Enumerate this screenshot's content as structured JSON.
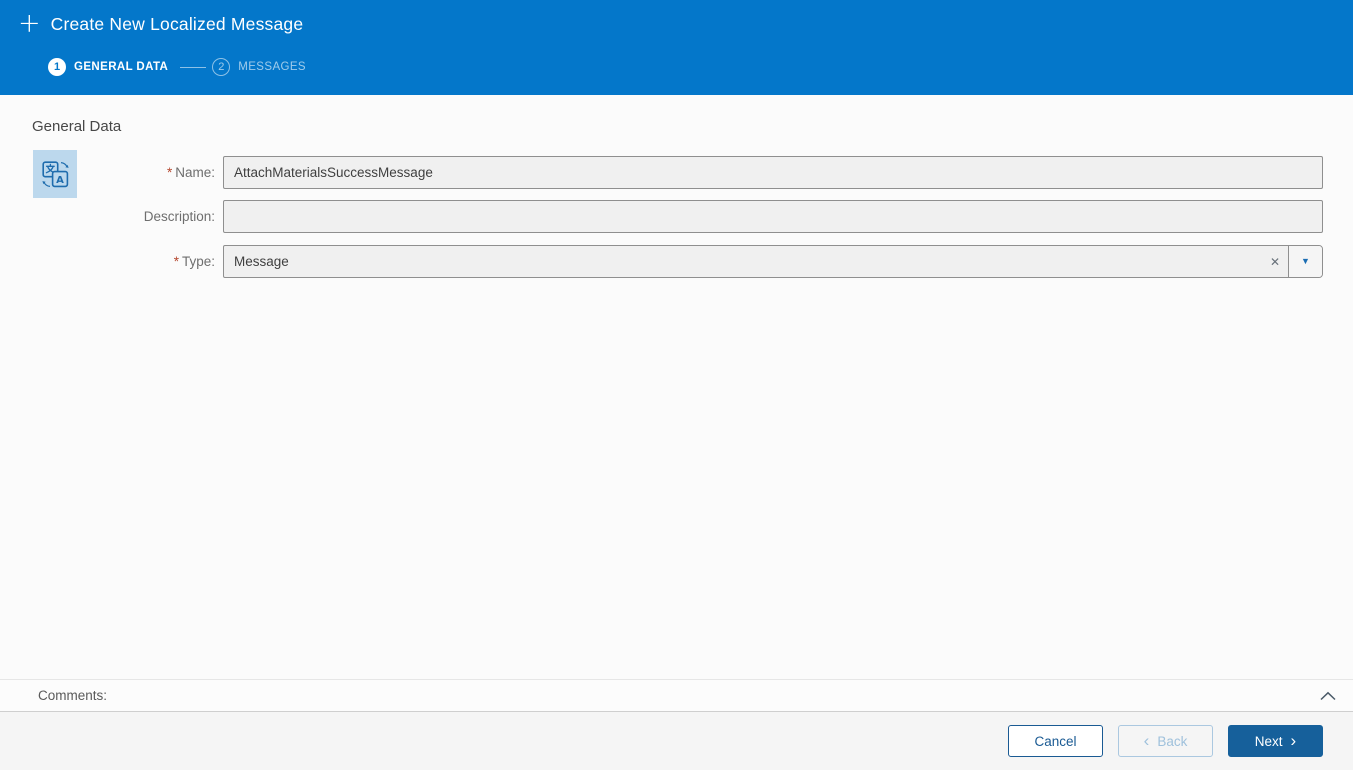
{
  "header": {
    "plus_glyph": "+",
    "title": "Create New Localized Message",
    "steps": [
      {
        "number": "1",
        "label": "GENERAL DATA",
        "state": "active"
      },
      {
        "number": "2",
        "label": "MESSAGES",
        "state": "inactive"
      }
    ]
  },
  "main": {
    "section_title": "General Data",
    "entity_icon": "translate-icon",
    "fields": [
      {
        "required_marker": "*",
        "label": "Name:",
        "value": "AttachMaterialsSuccessMessage"
      },
      {
        "required_marker": "",
        "label": "Description:",
        "value": ""
      },
      {
        "required_marker": "*",
        "label": "Type:",
        "value": "Message",
        "clear_glyph": "✕",
        "dropdown_glyph": "▼"
      }
    ]
  },
  "comments": {
    "label": "Comments:",
    "collapse_icon": "chevron-up"
  },
  "footer": {
    "cancel_label": "Cancel",
    "back_chevron": "‹",
    "back_label": "Back",
    "next_label": "Next",
    "next_chevron": "›"
  },
  "colors": {
    "header_blue": "#0477ca",
    "primary_button_blue": "#16609b",
    "outline_button_blue": "#1a5a93",
    "disabled_button_blue": "#9fc1dc",
    "icon_blue": "#1e6cad",
    "icon_background": "#bcd8ed",
    "required_marker_red": "#b5472e",
    "input_background": "#f0f0f0",
    "input_border": "#8f8f8f"
  }
}
